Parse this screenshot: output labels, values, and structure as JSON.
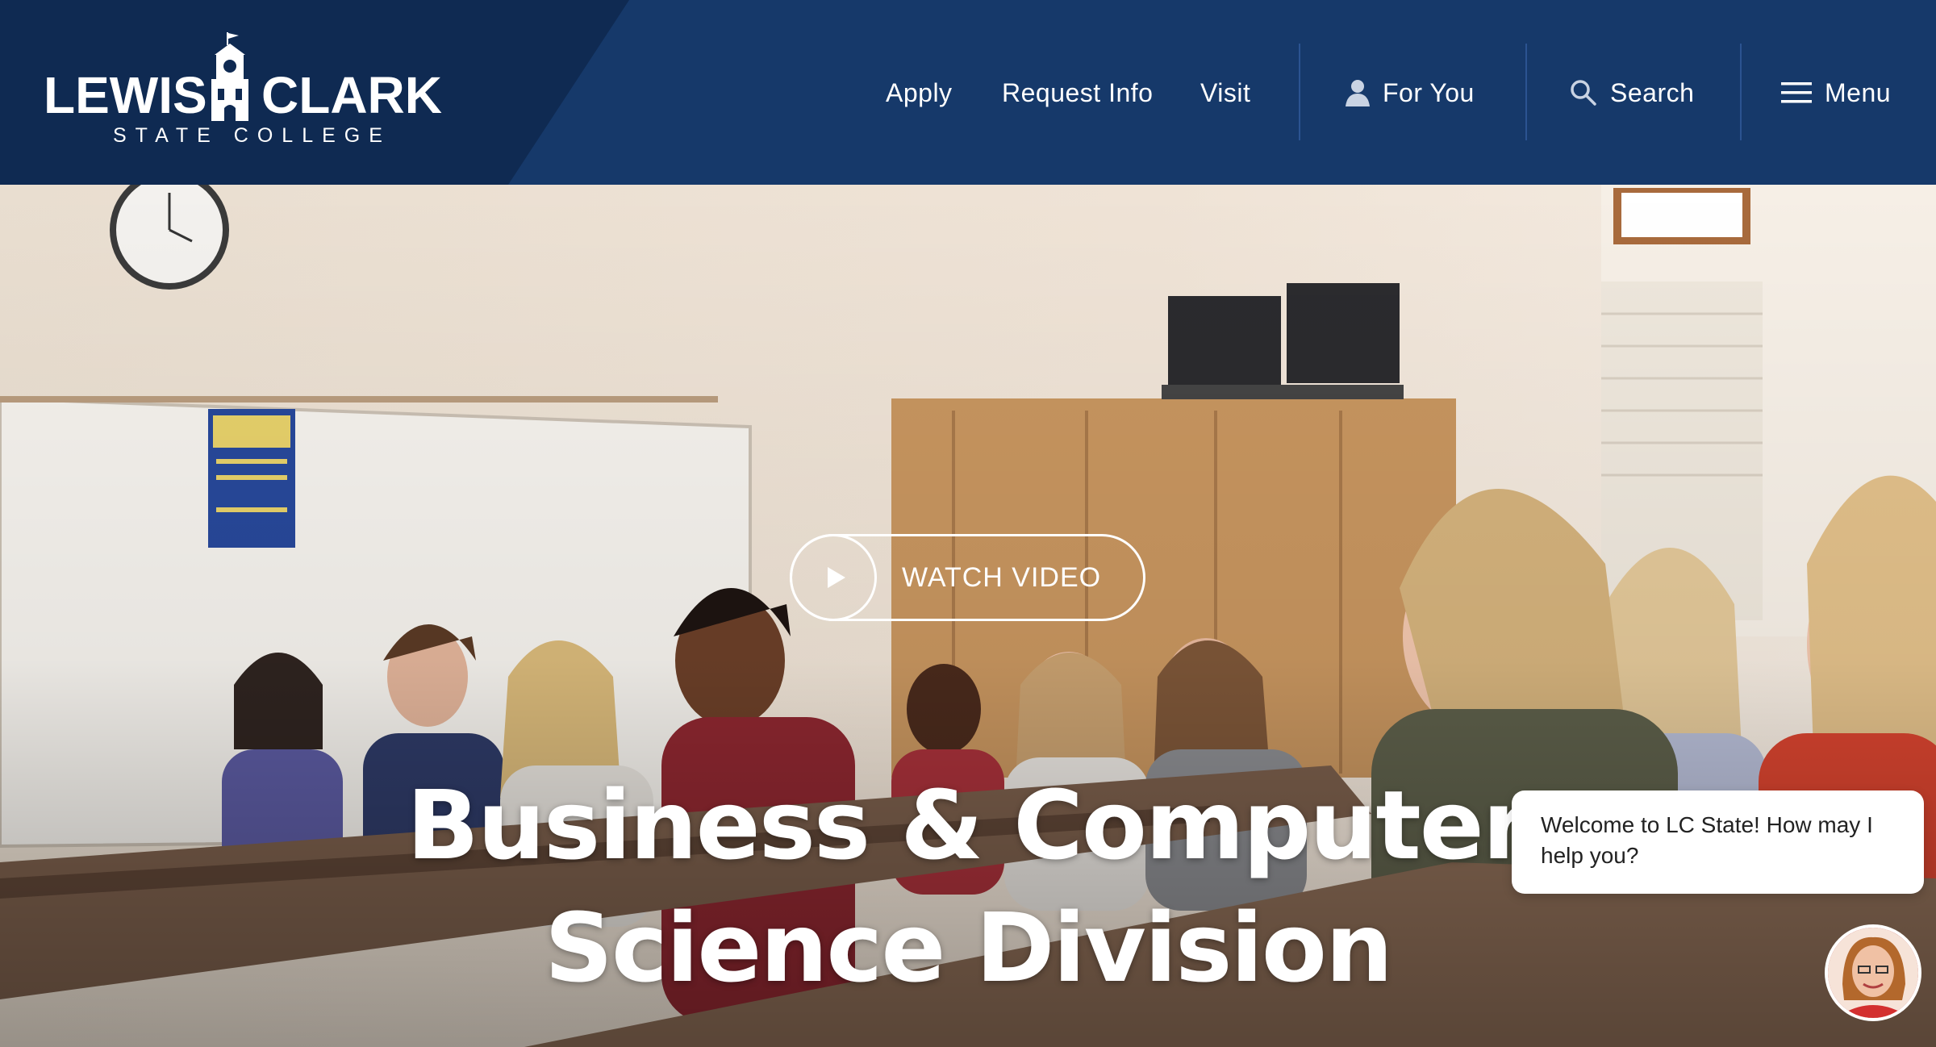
{
  "header": {
    "logo": {
      "word_left": "LEWIS",
      "word_right": "CLARK",
      "subtitle": "STATE COLLEGE"
    },
    "nav": {
      "apply": "Apply",
      "request_info": "Request Info",
      "visit": "Visit",
      "for_you": "For You",
      "search": "Search",
      "menu": "Menu"
    },
    "colors": {
      "header_bg": "#16396a",
      "logo_panel_bg": "#0f2a52",
      "separator": "#2b5391"
    }
  },
  "hero": {
    "watch_video": "WATCH VIDEO",
    "title_line1": "Business & Computer",
    "title_line2": "Science Division"
  },
  "chat": {
    "message": "Welcome to LC State! How may I help you?"
  },
  "icons": [
    "user-icon",
    "search-icon",
    "hamburger-menu-icon",
    "play-icon",
    "clock-tower-logo-icon"
  ]
}
